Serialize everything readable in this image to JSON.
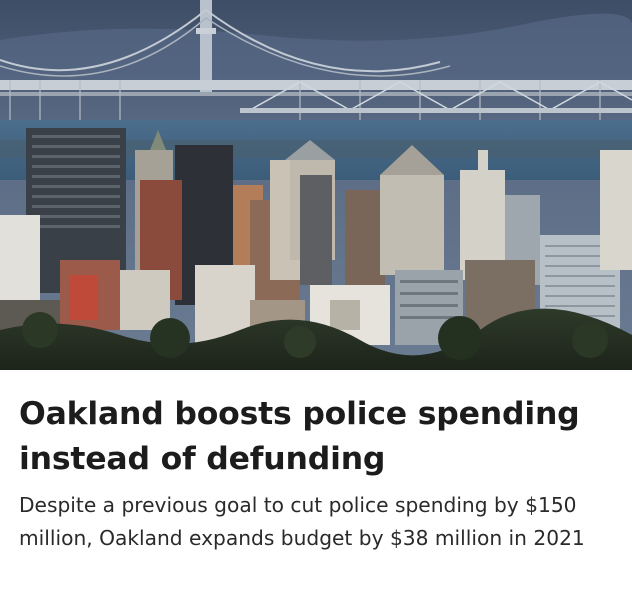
{
  "article": {
    "image_alt": "Oakland city skyline with the Bay Bridge behind it",
    "headline": "Oakland boosts police spending instead of defunding",
    "summary": "Despite a previous goal to cut police spending by $150 million, Oakland expands budget by $38 million in 2021"
  },
  "colors": {
    "headline_text": "#1c1c1c",
    "summary_text": "#2a2a2a",
    "background": "#ffffff"
  }
}
